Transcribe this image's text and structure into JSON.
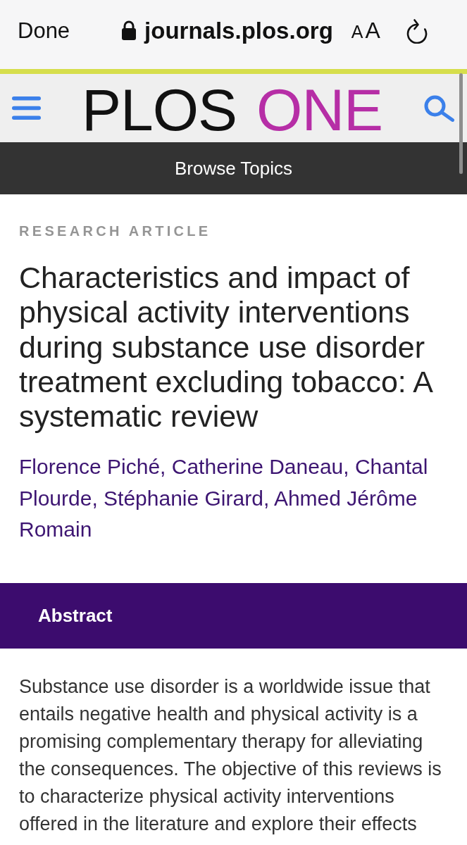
{
  "browser": {
    "done_label": "Done",
    "url": "journals.plos.org",
    "text_size_label": "AA"
  },
  "site_header": {
    "logo": [
      {
        "text": "PLOS",
        "color": "#111111"
      },
      {
        "text": "ONE",
        "color": "#b62ea6"
      }
    ]
  },
  "nav": {
    "browse_label": "Browse Topics"
  },
  "article": {
    "type_label": "RESEARCH ARTICLE",
    "title": "Characteristics and impact of physical activity interventions during substance use disorder treatment excluding tobacco: A systematic review",
    "authors": "Florence Piché, Catherine Daneau, Chantal Plourde, Stéphanie Girard, Ahmed Jérôme Romain"
  },
  "abstract": {
    "heading": "Abstract",
    "text": "Substance use disorder is a worldwide issue that entails negative health and physical activity is a promising complementary therapy for alleviating the consequences. The objective of this reviews is to characterize physical activity interventions offered in the literature and explore their effects"
  }
}
